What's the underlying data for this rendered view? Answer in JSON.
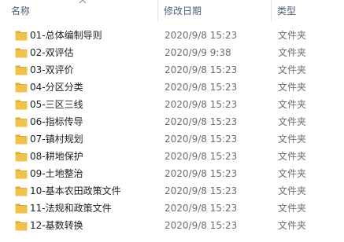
{
  "columns": {
    "name": "名称",
    "date": "修改日期",
    "type": "类型"
  },
  "icons": {
    "sort": "chevron-up-icon",
    "folder": "folder-icon",
    "folder_color": "#f0c24b"
  },
  "files": [
    {
      "name": "01-总体编制导则",
      "date": "2020/9/8 15:23",
      "type": "文件夹"
    },
    {
      "name": "02-双评估",
      "date": "2020/9/9 9:38",
      "type": "文件夹"
    },
    {
      "name": "03-双评价",
      "date": "2020/9/8 15:23",
      "type": "文件夹"
    },
    {
      "name": "04-分区分类",
      "date": "2020/9/8 15:23",
      "type": "文件夹"
    },
    {
      "name": "05-三区三线",
      "date": "2020/9/8 15:23",
      "type": "文件夹"
    },
    {
      "name": "06-指标传导",
      "date": "2020/9/8 15:23",
      "type": "文件夹"
    },
    {
      "name": "07-镇村规划",
      "date": "2020/9/8 15:23",
      "type": "文件夹"
    },
    {
      "name": "08-耕地保护",
      "date": "2020/9/8 15:23",
      "type": "文件夹"
    },
    {
      "name": "09-土地整治",
      "date": "2020/9/8 15:23",
      "type": "文件夹"
    },
    {
      "name": "10-基本农田政策文件",
      "date": "2020/9/8 15:23",
      "type": "文件夹"
    },
    {
      "name": "11-法规和政策文件",
      "date": "2020/9/8 15:23",
      "type": "文件夹"
    },
    {
      "name": "12-基数转换",
      "date": "2020/9/8 15:23",
      "type": "文件夹"
    }
  ]
}
